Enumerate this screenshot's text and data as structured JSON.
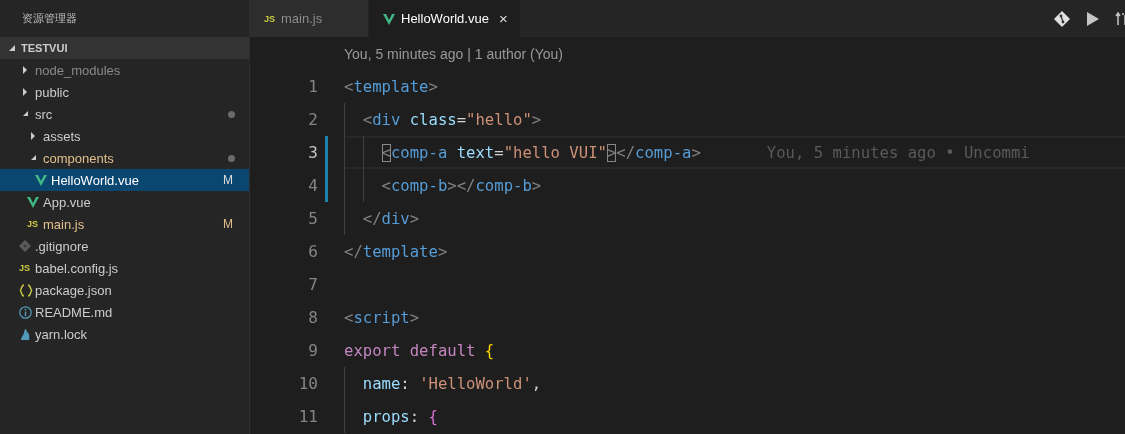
{
  "sidebar": {
    "title": "资源管理器",
    "section": {
      "label": "TESTVUI",
      "expanded": true
    },
    "tree": [
      {
        "label": "node_modules",
        "kind": "folder",
        "expanded": false,
        "ignored": true,
        "modified_dot": false,
        "selected": false
      },
      {
        "label": "public",
        "kind": "folder",
        "expanded": false,
        "ignored": false,
        "modified_dot": false,
        "selected": false
      },
      {
        "label": "src",
        "kind": "folder",
        "expanded": true,
        "ignored": false,
        "modified_dot": true,
        "selected": false,
        "children": [
          {
            "label": "assets",
            "kind": "folder",
            "expanded": false,
            "ignored": false,
            "modified_dot": false,
            "selected": false
          },
          {
            "label": "components",
            "kind": "folder",
            "expanded": true,
            "ignored": false,
            "modified_dot": true,
            "selected": false,
            "children": [
              {
                "label": "HelloWorld.vue",
                "kind": "vue",
                "badge": "M",
                "selected": true
              }
            ]
          },
          {
            "label": "App.vue",
            "kind": "vue",
            "selected": false
          },
          {
            "label": "main.js",
            "kind": "js",
            "icon_text": "JS",
            "badge": "M",
            "selected": false
          }
        ]
      },
      {
        "label": ".gitignore",
        "kind": "git",
        "selected": false
      },
      {
        "label": "babel.config.js",
        "kind": "js",
        "icon_text": "JS",
        "selected": false
      },
      {
        "label": "package.json",
        "kind": "json",
        "selected": false
      },
      {
        "label": "README.md",
        "kind": "info",
        "selected": false
      },
      {
        "label": "yarn.lock",
        "kind": "yarn",
        "selected": false
      }
    ]
  },
  "editor": {
    "tabs": [
      {
        "label": "main.js",
        "kind": "js",
        "icon_text": "JS",
        "selected": false
      },
      {
        "label": "HelloWorld.vue",
        "kind": "vue",
        "selected": true,
        "close": "×"
      }
    ],
    "codelens": "You, 5 minutes ago | 1 author (You)",
    "lines": [
      {
        "number": "1",
        "current": false,
        "modified": false,
        "tokens": [
          {
            "kind": "punct",
            "text": "<"
          },
          {
            "kind": "tag",
            "text": "template"
          },
          {
            "kind": "punct",
            "text": ">"
          }
        ]
      },
      {
        "number": "2",
        "current": false,
        "modified": false,
        "tokens": [
          {
            "kind": "punct",
            "text": "  <"
          },
          {
            "kind": "tag",
            "text": "div"
          },
          {
            "kind": "attr",
            "text": " class"
          },
          {
            "kind": "plain",
            "text": "="
          },
          {
            "kind": "string",
            "text": "\"hello\""
          },
          {
            "kind": "punct",
            "text": ">"
          }
        ]
      },
      {
        "number": "3",
        "current": true,
        "modified": true,
        "tokens": [
          {
            "kind": "punct",
            "text": "    <",
            "matched": true
          },
          {
            "kind": "tag",
            "text": "comp-a"
          },
          {
            "kind": "attr",
            "text": " text"
          },
          {
            "kind": "plain",
            "text": "="
          },
          {
            "kind": "string",
            "text": "\"hello VUI\""
          },
          {
            "kind": "punct",
            "text": ">",
            "matched": true
          },
          {
            "kind": "punct",
            "text": "</"
          },
          {
            "kind": "tag",
            "text": "comp-a"
          },
          {
            "kind": "punct",
            "text": ">"
          },
          {
            "kind": "blame",
            "text": "You, 5 minutes ago • Uncommi"
          }
        ]
      },
      {
        "number": "4",
        "current": false,
        "modified": true,
        "tokens": [
          {
            "kind": "punct",
            "text": "    <"
          },
          {
            "kind": "tag",
            "text": "comp-b"
          },
          {
            "kind": "punct",
            "text": "></"
          },
          {
            "kind": "tag",
            "text": "comp-b"
          },
          {
            "kind": "punct",
            "text": ">"
          }
        ]
      },
      {
        "number": "5",
        "current": false,
        "modified": false,
        "tokens": [
          {
            "kind": "punct",
            "text": "  </"
          },
          {
            "kind": "tag",
            "text": "div"
          },
          {
            "kind": "punct",
            "text": ">"
          }
        ]
      },
      {
        "number": "6",
        "current": false,
        "modified": false,
        "tokens": [
          {
            "kind": "punct",
            "text": "</"
          },
          {
            "kind": "tag",
            "text": "template"
          },
          {
            "kind": "punct",
            "text": ">"
          }
        ]
      },
      {
        "number": "7",
        "current": false,
        "modified": false
      },
      {
        "number": "8",
        "current": false,
        "modified": false,
        "tokens": [
          {
            "kind": "punct",
            "text": "<"
          },
          {
            "kind": "tag",
            "text": "script"
          },
          {
            "kind": "punct",
            "text": ">"
          }
        ]
      },
      {
        "number": "9",
        "current": false,
        "modified": false,
        "tokens": [
          {
            "kind": "keyword",
            "text": "export default"
          },
          {
            "kind": "brace",
            "text": " {"
          }
        ]
      },
      {
        "number": "10",
        "current": false,
        "modified": false,
        "tokens": [
          {
            "kind": "prop",
            "text": "  name"
          },
          {
            "kind": "plain",
            "text": ":"
          },
          {
            "kind": "string",
            "text": " 'HelloWorld'"
          },
          {
            "kind": "plain",
            "text": ","
          }
        ]
      },
      {
        "number": "11",
        "current": false,
        "modified": false,
        "tokens": [
          {
            "kind": "prop",
            "text": "  props"
          },
          {
            "kind": "plain",
            "text": ":"
          },
          {
            "kind": "brace2",
            "text": " {"
          }
        ]
      }
    ]
  }
}
